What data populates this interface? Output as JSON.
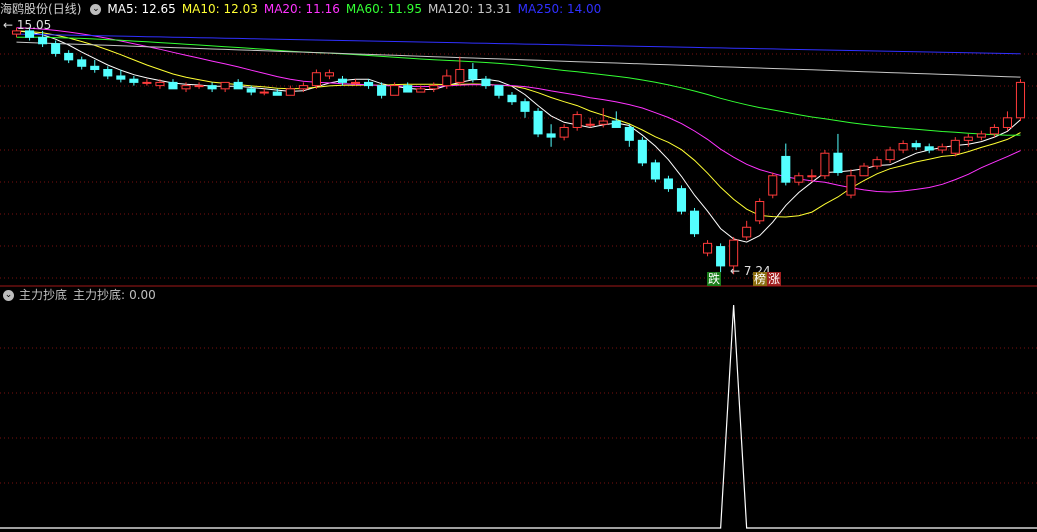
{
  "stock": {
    "name": "海鸥股份",
    "period": "(日线)"
  },
  "ma": [
    {
      "label": "MA5:",
      "value": "12.65",
      "color": "#ffffff"
    },
    {
      "label": "MA10:",
      "value": "12.03",
      "color": "#ffff33"
    },
    {
      "label": "MA20:",
      "value": "11.16",
      "color": "#ff33ff"
    },
    {
      "label": "MA60:",
      "value": "11.95",
      "color": "#33ff33"
    },
    {
      "label": "MA120:",
      "value": "13.31",
      "color": "#c8c8c8"
    },
    {
      "label": "MA250:",
      "value": "14.00",
      "color": "#3030ff"
    }
  ],
  "price_marks": {
    "high": "15.05",
    "low": "7.24",
    "high_arrow": "←",
    "low_arrow": "←"
  },
  "signals": [
    {
      "text": "跌",
      "bg": "#1a7d1a",
      "color": "#ffffff"
    },
    {
      "text": "榜",
      "bg": "#8a6d10",
      "color": "#ffffff"
    },
    {
      "text": "涨",
      "bg": "#a11f1f",
      "color": "#ffffff"
    }
  ],
  "indicator": {
    "name": "主力抄底",
    "label": "主力抄底:",
    "value": "0.00"
  },
  "chart_data": {
    "type": "candlestick",
    "ohlc": [
      [
        14.7,
        14.9,
        14.6,
        14.8
      ],
      [
        14.8,
        14.9,
        14.5,
        14.6
      ],
      [
        14.6,
        14.8,
        14.3,
        14.4
      ],
      [
        14.4,
        14.5,
        14.0,
        14.1
      ],
      [
        14.1,
        14.2,
        13.8,
        13.9
      ],
      [
        13.9,
        14.0,
        13.6,
        13.7
      ],
      [
        13.7,
        13.9,
        13.5,
        13.6
      ],
      [
        13.6,
        13.7,
        13.3,
        13.4
      ],
      [
        13.4,
        13.6,
        13.2,
        13.3
      ],
      [
        13.3,
        13.4,
        13.1,
        13.2
      ],
      [
        13.2,
        13.3,
        13.1,
        13.2
      ],
      [
        13.1,
        13.3,
        13.0,
        13.2
      ],
      [
        13.2,
        13.3,
        13.0,
        13.0
      ],
      [
        13.0,
        13.2,
        12.9,
        13.1
      ],
      [
        13.1,
        13.2,
        13.0,
        13.1
      ],
      [
        13.1,
        13.2,
        12.9,
        13.0
      ],
      [
        13.0,
        13.2,
        12.9,
        13.2
      ],
      [
        13.2,
        13.3,
        13.0,
        13.0
      ],
      [
        13.0,
        13.1,
        12.8,
        12.9
      ],
      [
        12.9,
        13.0,
        12.8,
        12.9
      ],
      [
        12.9,
        13.0,
        12.8,
        12.8
      ],
      [
        12.8,
        13.1,
        12.8,
        13.0
      ],
      [
        13.0,
        13.2,
        12.9,
        13.1
      ],
      [
        13.1,
        13.6,
        13.0,
        13.5
      ],
      [
        13.4,
        13.6,
        13.3,
        13.5
      ],
      [
        13.3,
        13.4,
        13.1,
        13.2
      ],
      [
        13.2,
        13.3,
        13.1,
        13.2
      ],
      [
        13.2,
        13.3,
        13.0,
        13.1
      ],
      [
        13.1,
        13.2,
        12.7,
        12.8
      ],
      [
        12.8,
        13.2,
        12.8,
        13.1
      ],
      [
        13.1,
        13.2,
        12.9,
        12.9
      ],
      [
        12.9,
        13.1,
        12.9,
        13.0
      ],
      [
        13.0,
        13.2,
        12.9,
        13.1
      ],
      [
        13.1,
        13.6,
        13.0,
        13.4
      ],
      [
        13.2,
        14.0,
        13.1,
        13.6
      ],
      [
        13.6,
        13.8,
        13.2,
        13.3
      ],
      [
        13.3,
        13.4,
        13.0,
        13.1
      ],
      [
        13.1,
        13.1,
        12.7,
        12.8
      ],
      [
        12.8,
        12.9,
        12.5,
        12.6
      ],
      [
        12.6,
        12.7,
        12.1,
        12.3
      ],
      [
        12.3,
        12.4,
        11.5,
        11.6
      ],
      [
        11.6,
        11.9,
        11.2,
        11.5
      ],
      [
        11.5,
        11.9,
        11.4,
        11.8
      ],
      [
        11.8,
        12.3,
        11.7,
        12.2
      ],
      [
        11.9,
        12.1,
        11.8,
        11.9
      ],
      [
        11.9,
        12.4,
        11.8,
        12.0
      ],
      [
        12.0,
        12.3,
        11.8,
        11.8
      ],
      [
        11.8,
        11.9,
        11.2,
        11.4
      ],
      [
        11.4,
        11.5,
        10.6,
        10.7
      ],
      [
        10.7,
        10.8,
        10.1,
        10.2
      ],
      [
        10.2,
        10.3,
        9.8,
        9.9
      ],
      [
        9.9,
        10.0,
        9.1,
        9.2
      ],
      [
        9.2,
        9.3,
        8.4,
        8.5
      ],
      [
        7.9,
        8.3,
        7.8,
        8.2
      ],
      [
        8.1,
        8.2,
        7.3,
        7.5
      ],
      [
        7.5,
        8.4,
        7.24,
        8.3
      ],
      [
        8.4,
        8.9,
        8.3,
        8.7
      ],
      [
        8.9,
        9.6,
        8.8,
        9.5
      ],
      [
        9.7,
        10.4,
        9.6,
        10.3
      ],
      [
        10.9,
        11.3,
        10.0,
        10.1
      ],
      [
        10.1,
        10.4,
        10.0,
        10.3
      ],
      [
        10.3,
        10.5,
        10.1,
        10.3
      ],
      [
        10.3,
        11.1,
        10.2,
        11.0
      ],
      [
        11.0,
        11.6,
        10.3,
        10.4
      ],
      [
        9.7,
        10.5,
        9.6,
        10.3
      ],
      [
        10.3,
        10.7,
        10.3,
        10.6
      ],
      [
        10.6,
        10.9,
        10.5,
        10.8
      ],
      [
        10.8,
        11.2,
        10.7,
        11.1
      ],
      [
        11.1,
        11.4,
        11.0,
        11.3
      ],
      [
        11.3,
        11.4,
        11.1,
        11.2
      ],
      [
        11.2,
        11.3,
        11.0,
        11.1
      ],
      [
        11.1,
        11.3,
        11.0,
        11.2
      ],
      [
        11.0,
        11.5,
        10.9,
        11.4
      ],
      [
        11.4,
        11.6,
        11.2,
        11.5
      ],
      [
        11.5,
        11.7,
        11.4,
        11.6
      ],
      [
        11.6,
        11.9,
        11.5,
        11.8
      ],
      [
        11.8,
        12.3,
        11.7,
        12.1
      ],
      [
        12.1,
        13.3,
        12.0,
        13.2
      ]
    ],
    "ma_series": [
      {
        "name": "MA5",
        "color": "#ffffff"
      },
      {
        "name": "MA10",
        "color": "#ffff33"
      },
      {
        "name": "MA20",
        "color": "#ff33ff"
      },
      {
        "name": "MA60",
        "color": "#33ff33"
      },
      {
        "name": "MA120",
        "color": "#c8c8c8"
      },
      {
        "name": "MA250",
        "color": "#3030ff"
      }
    ],
    "signal": {
      "index": 55,
      "value": 1
    },
    "up_color": "#ff3b3b",
    "down_color": "#54ffff",
    "price_range": [
      7.0,
      15.2
    ]
  }
}
